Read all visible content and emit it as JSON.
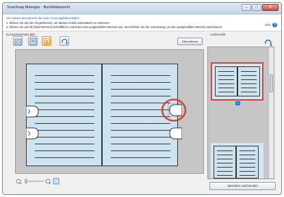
{
  "window": {
    "title": "ScanSnap Manager - Buchbildansicht"
  },
  "instructions": {
    "heading": "Sie müssen den Bereich die nach Trennungsbild erstellen",
    "step1": "1. Klicken Sie auf den Fingerbereich, um dessen Größe automatisch zu erkennen",
    "step2": "2. Klicken Sie auf die [Übernehmen]-Schaltfläche und Ecken des ausgewählten Bereich aus. Verschieben Sie die Umrandung, um den ausgewählten Bereich auszubauen.",
    "help_label": "Hilfe"
  },
  "editor": {
    "section_label": "Zu bearbeitendes Bild",
    "apply_label": "Übernehmen",
    "tools": [
      "hand-tool-icon",
      "page-view-icon",
      "finger-select-icon",
      "rotate-icon"
    ]
  },
  "preview": {
    "section_label": "Letztes Bild",
    "page_number": "1"
  },
  "footer": {
    "save_label": "Speichern und beenden"
  },
  "colors": {
    "page": "#cde3f0",
    "highlight": "#d6453a",
    "accent": "#2a7ad6"
  }
}
